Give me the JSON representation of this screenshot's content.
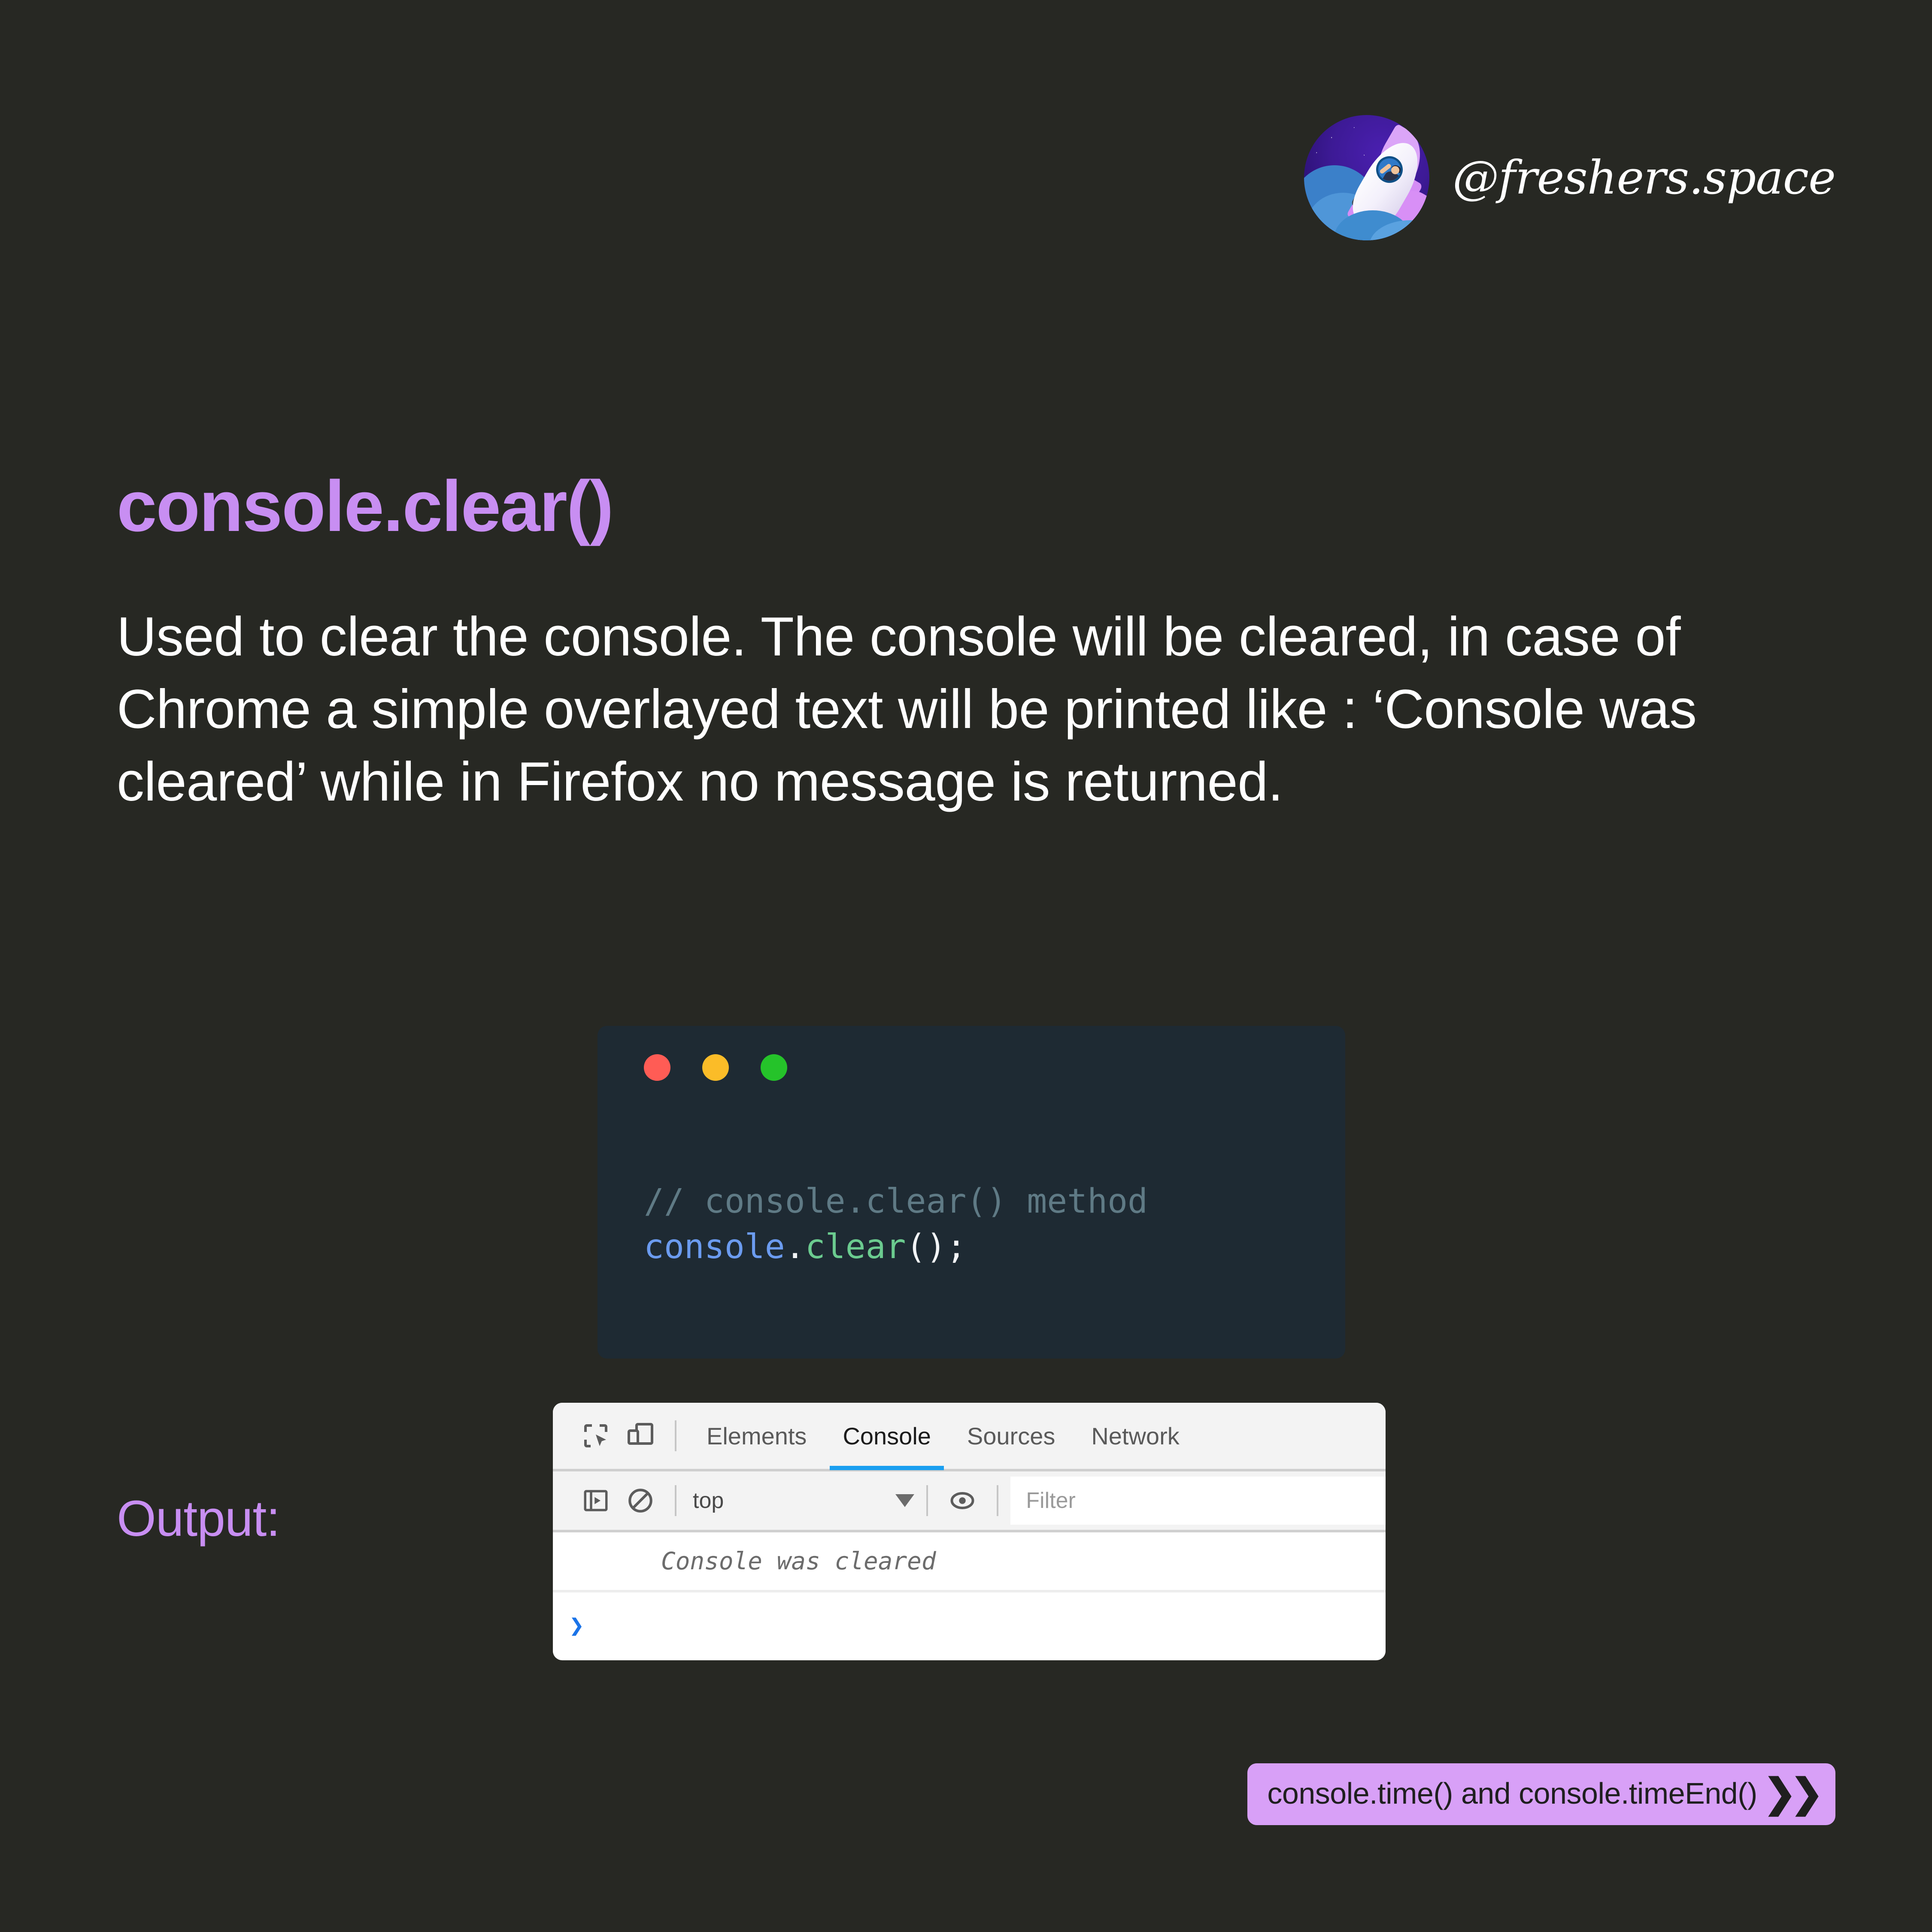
{
  "brand": {
    "handle": "@freshers.space",
    "avatar_icon": "rocket-avatar-icon"
  },
  "title": "console.clear()",
  "body_text": "Used to clear the console. The console will be cleared, in case of Chrome a simple overlayed text will be printed like : ‘Console was cleared’ while in Firefox no message is returned.",
  "code_card": {
    "window_dots": [
      "close-red",
      "minimize-amber",
      "maximize-green"
    ],
    "comment": "// console.clear() method",
    "object": "console",
    "dot": ".",
    "method": "clear",
    "tail": "();"
  },
  "output_label": "Output:",
  "devtools": {
    "toolbar_icons": [
      "inspect-element-icon",
      "device-toolbar-icon"
    ],
    "tabs": [
      {
        "label": "Elements",
        "active": false
      },
      {
        "label": "Console",
        "active": true
      },
      {
        "label": "Sources",
        "active": false
      },
      {
        "label": "Network",
        "active": false
      }
    ],
    "filterbar_icons": [
      "sidebar-toggle-icon",
      "clear-console-icon",
      "eye-icon"
    ],
    "context_value": "top",
    "filter_placeholder": "Filter",
    "console_message": "Console was cleared",
    "prompt_symbol": "❯",
    "active_tab_color": "#1a9ff0"
  },
  "next_pill": {
    "label": "console.time() and console.timeEnd()",
    "chevrons": "❯❯",
    "background": "#d8a0f7"
  },
  "colors": {
    "page_background": "#272823",
    "accent_purple": "#c88ef2",
    "code_background": "#1e2a33",
    "code_comment": "#5f7a85",
    "code_object": "#6b9bef",
    "code_method": "#6bcb8f",
    "text_white": "#ffffff"
  }
}
